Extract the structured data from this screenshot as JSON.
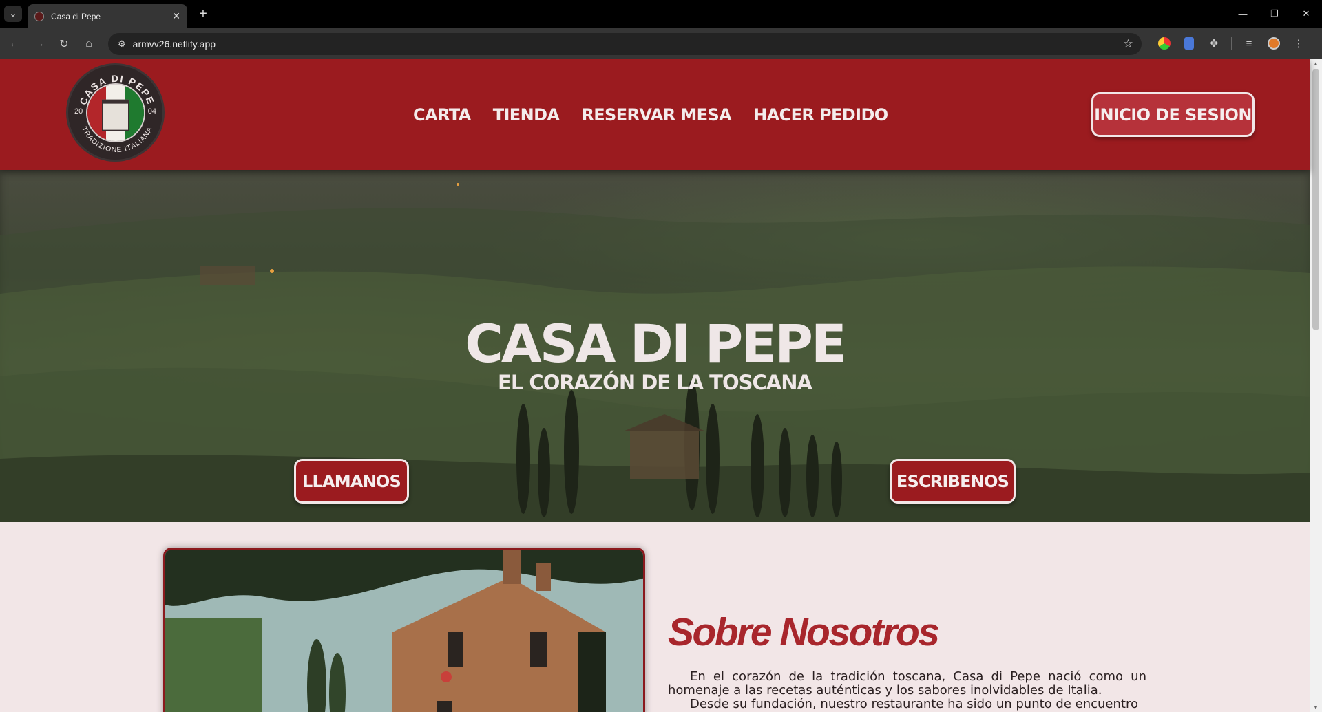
{
  "browser": {
    "tab_title": "Casa di Pepe",
    "url": "armvv26.netlify.app"
  },
  "header": {
    "logo_text_top": "CASA DI PEPE",
    "logo_text_bottom": "TRADIZIONE ITALIANA",
    "logo_year_left": "20",
    "logo_year_right": "04",
    "nav": [
      "CARTA",
      "TIENDA",
      "RESERVAR MESA",
      "HACER PEDIDO"
    ],
    "login_label": "INICIO DE SESION"
  },
  "hero": {
    "title": "CASA DI PEPE",
    "subtitle": "EL CORAZÓN DE LA TOSCANA",
    "call_label": "LLAMANOS",
    "write_label": "ESCRIBENOS"
  },
  "about": {
    "title": "Sobre Nosotros",
    "paragraph_1": "En el corazón de la tradición toscana, Casa di Pepe nació como un homenaje a las recetas auténticas y los sabores inolvidables de Italia.",
    "paragraph_2": "Desde su fundación, nuestro restaurante ha sido un punto de encuentro"
  },
  "colors": {
    "brand_red": "#9b1b1f",
    "page_bg": "#f2e6e7",
    "title_red": "#a8262c"
  }
}
